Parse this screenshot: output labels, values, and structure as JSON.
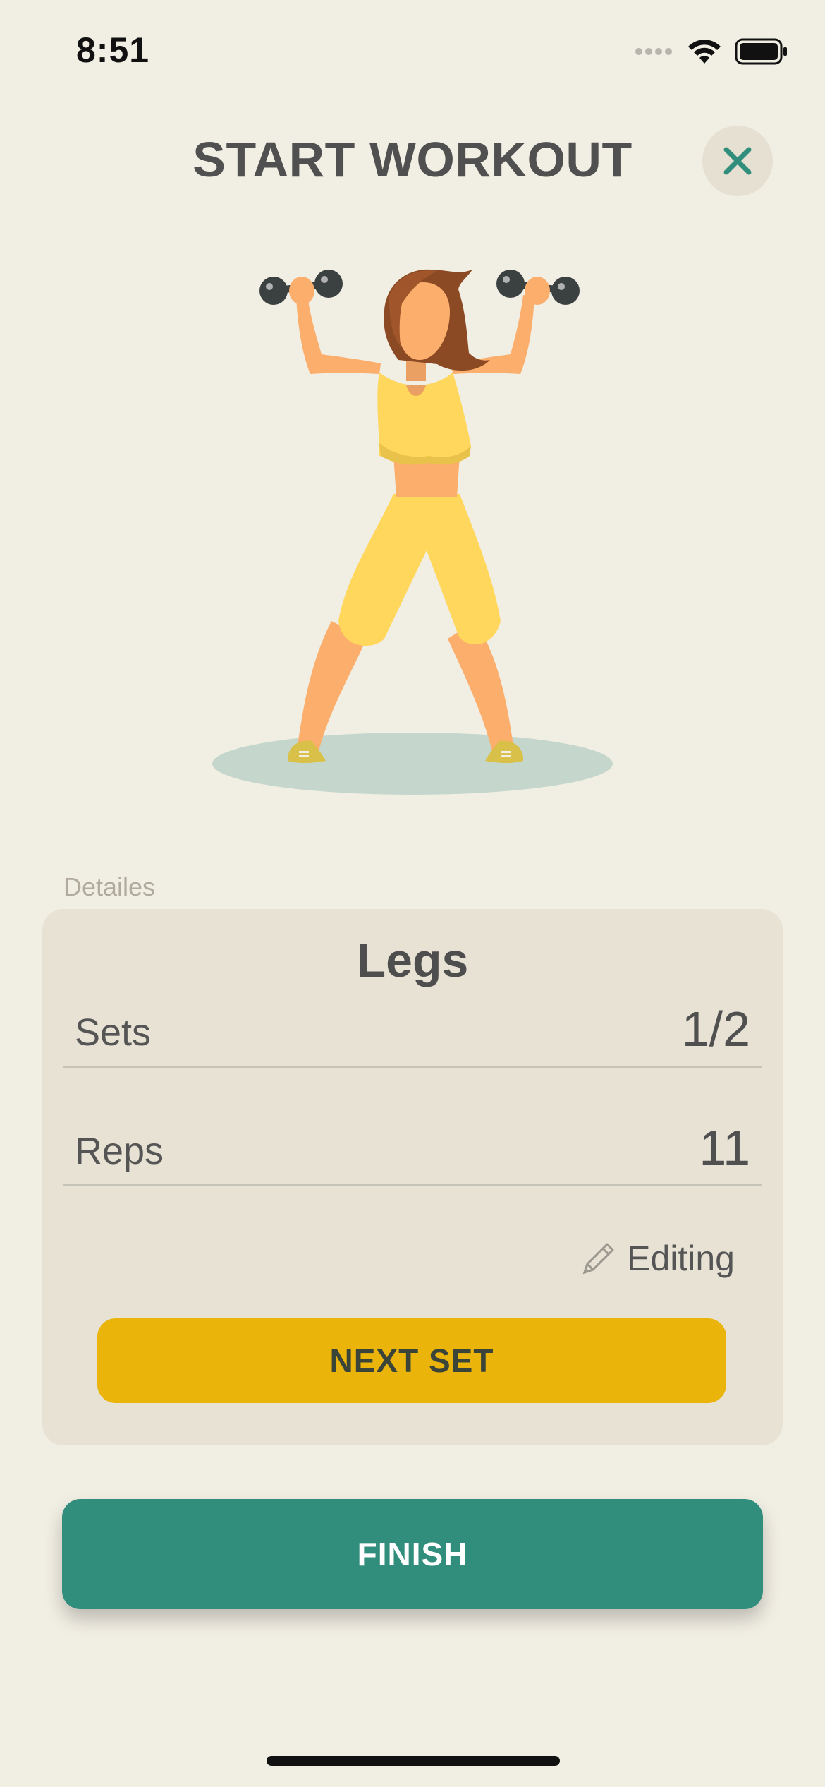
{
  "status_bar": {
    "time": "8:51",
    "icons": [
      "signal-dots-icon",
      "wifi-icon",
      "battery-icon"
    ]
  },
  "header": {
    "title": "START WORKOUT",
    "close_icon": "close-icon",
    "accent_color": "#328e7c"
  },
  "illustration": {
    "icon": "woman-dumbbell-illustration"
  },
  "details": {
    "section_label": "Detailes",
    "exercise_name": "Legs",
    "rows": [
      {
        "label": "Sets",
        "value": "1/2"
      },
      {
        "label": "Reps",
        "value": "11"
      }
    ],
    "edit_label": "Editing",
    "edit_icon": "pencil-icon",
    "next_button_label": "NEXT SET",
    "next_button_color": "#ebb40b"
  },
  "footer": {
    "finish_button_label": "FINISH",
    "finish_button_color": "#328e7c"
  },
  "colors": {
    "background": "#f1eee3",
    "card": "#e7e2d4"
  }
}
